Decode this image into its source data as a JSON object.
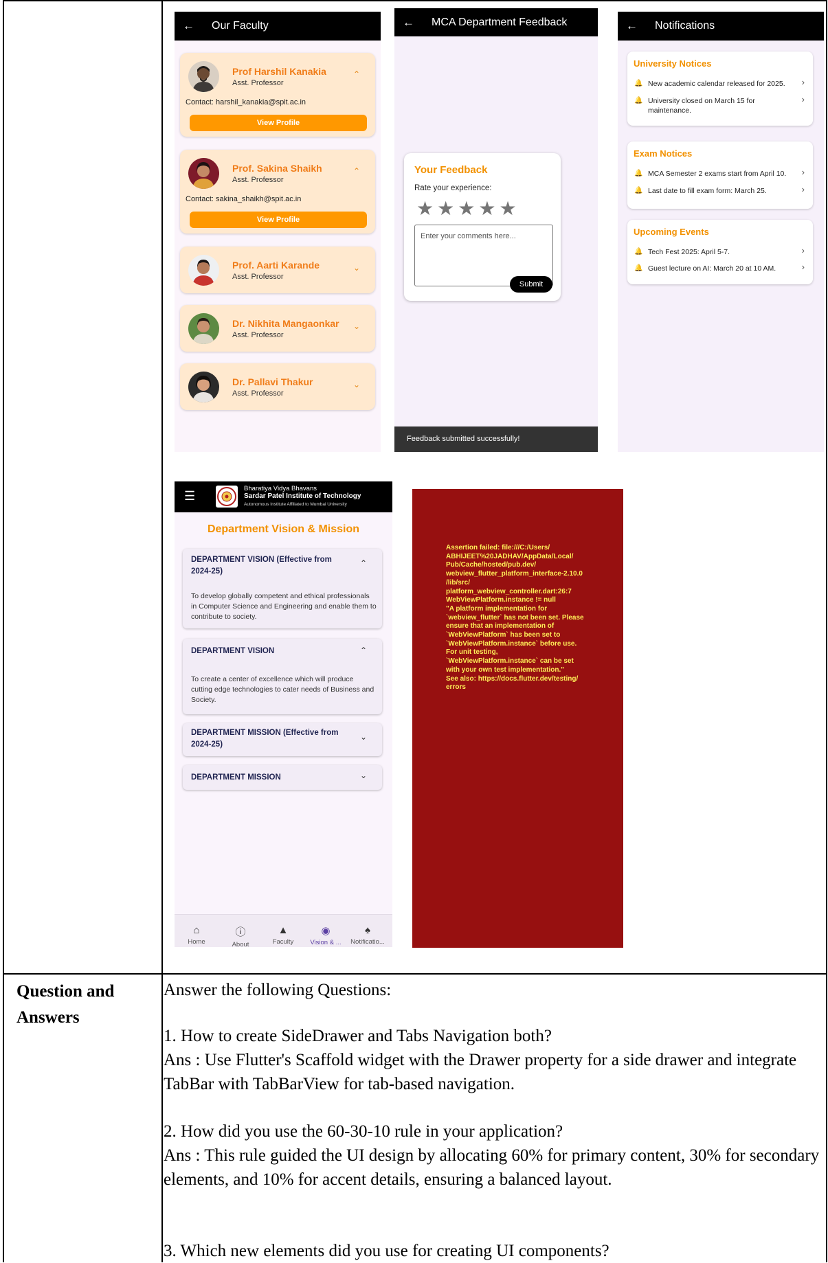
{
  "faculty_screen": {
    "title": "Our Faculty",
    "cards": [
      {
        "name": "Prof Harshil Kanakia",
        "designation": "Asst. Professor",
        "contact": "Contact: harshil_kanakia@spit.ac.in",
        "button": "View Profile",
        "expanded": true
      },
      {
        "name": "Prof. Sakina Shaikh",
        "designation": "Asst. Professor",
        "contact": "Contact: sakina_shaikh@spit.ac.in",
        "button": "View Profile",
        "expanded": true
      },
      {
        "name": "Prof. Aarti Karande",
        "designation": "Asst. Professor"
      },
      {
        "name": "Dr. Nikhita Mangaonkar",
        "designation": "Asst. Professor"
      },
      {
        "name": "Dr. Pallavi Thakur",
        "designation": "Asst. Professor"
      }
    ]
  },
  "feedback_screen": {
    "title": "MCA Department Feedback",
    "card_title": "Your Feedback",
    "rate_label": "Rate your experience:",
    "star_count": 5,
    "comment_placeholder": "Enter your comments here...",
    "submit_label": "Submit",
    "snackbar": "Feedback submitted successfully!"
  },
  "notifications_screen": {
    "title": "Notifications",
    "sections": [
      {
        "title": "University Notices",
        "items": [
          "New academic calendar released for 2025.",
          "University closed on March 15 for maintenance."
        ]
      },
      {
        "title": "Exam Notices",
        "items": [
          "MCA Semester 2 exams start from April 10.",
          "Last date to fill exam form: March 25."
        ]
      },
      {
        "title": "Upcoming Events",
        "items": [
          "Tech Fest 2025: April 5-7.",
          "Guest lecture on AI: March 20 at 10 AM."
        ]
      }
    ]
  },
  "vision_screen": {
    "header_line1": "Bharatiya Vidya Bhavans",
    "header_line2": "Sardar Patel Institute of Technology",
    "header_line3": "Autonomous Institute Affiliated to Mumbai University",
    "page_title": "Department Vision & Mission",
    "panels": [
      {
        "heading": "DEPARTMENT VISION (Effective from 2024-25)",
        "body": "To develop globally competent and ethical professionals in Computer Science and Engineering and enable them to contribute to society.",
        "expanded": true
      },
      {
        "heading": "DEPARTMENT VISION",
        "body": "To create a center of excellence which will produce cutting edge technologies to cater needs of Business and Society.",
        "expanded": true
      },
      {
        "heading": "DEPARTMENT MISSION (Effective from 2024-25)",
        "expanded": false
      },
      {
        "heading": "DEPARTMENT MISSION",
        "expanded": false
      }
    ],
    "nav": [
      {
        "label": "Home",
        "icon": "home-icon"
      },
      {
        "label": "About",
        "icon": "info-icon"
      },
      {
        "label": "Faculty",
        "icon": "school-icon"
      },
      {
        "label": "Vision & ...",
        "icon": "eye-icon"
      },
      {
        "label": "Notificatio...",
        "icon": "bell-icon"
      }
    ]
  },
  "error_screen": {
    "message": "Assertion failed: file:///C:/Users/\nABHIJEET%20JADHAV/AppData/Local/\nPub/Cache/hosted/pub.dev/\nwebview_flutter_platform_interface-2.10.0\n/lib/src/\nplatform_webview_controller.dart:26:7\nWebViewPlatform.instance != null\n\"A platform implementation for\n`webview_flutter` has not been set. Please\nensure that an implementation of\n`WebViewPlatform` has been set to\n`WebViewPlatform.instance` before use.\nFor unit testing,\n`WebViewPlatform.instance` can be set\nwith your own test implementation.\"\nSee also: https://docs.flutter.dev/testing/\nerrors",
    "background": "#971010",
    "text_color": "#ffee58"
  },
  "qa_section": {
    "label": "Question and\nAnswers",
    "intro": "Answer the following Questions:",
    "q1": "1.   How to create SideDrawer and Tabs Navigation both?",
    "a1": " Ans : Use Flutter's Scaffold widget with the Drawer property for a side drawer and integrate TabBar with TabBarView for tab-based navigation.",
    "q2": "2.   How did you use the 60-30-10 rule in your application?",
    "a2": " Ans : This rule guided the UI design by allocating 60% for primary content, 30% for secondary elements, and 10% for accent details, ensuring a balanced layout.",
    "q3": "3.   Which new elements did you use for creating UI components?"
  }
}
